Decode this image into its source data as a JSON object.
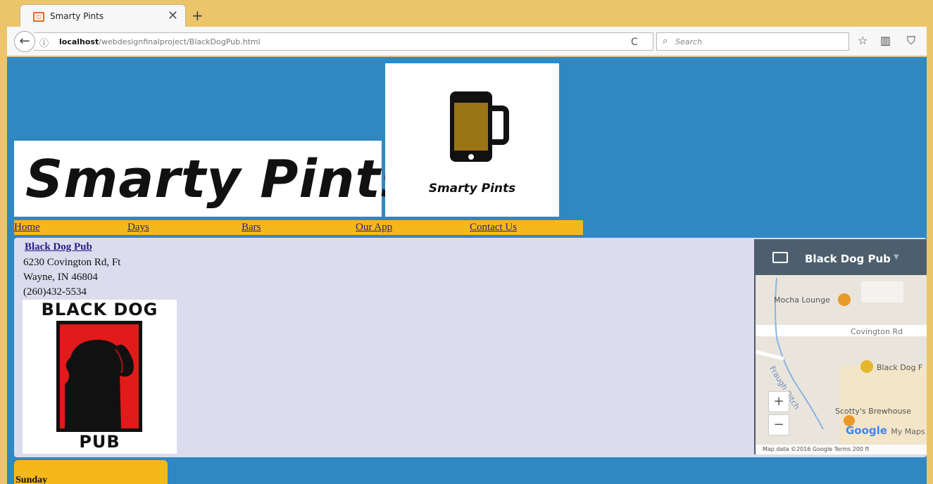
{
  "browser": {
    "tab_title": "Smarty Pints",
    "tab_close": "✕",
    "new_tab": "+",
    "back": "←",
    "url_host": "localhost",
    "url_path": "/webdesignfinalproject/BlackDogPub.html",
    "reload": "C",
    "search_placeholder": "Search",
    "icons": [
      "back-icon",
      "info-icon",
      "reload-icon",
      "search-icon",
      "star-icon",
      "library-icon",
      "pocket-icon"
    ]
  },
  "header": {
    "title": "Smarty Pints",
    "logo_caption": "Smarty Pints"
  },
  "nav": {
    "items": [
      "Home",
      "Days",
      "Bars",
      "Our App",
      "Contact Us"
    ]
  },
  "bar": {
    "name": "Black Dog Pub",
    "address_line1": "6230 Covington Rd, Ft",
    "address_line2": "Wayne, IN 46804",
    "phone": "(260)432-5534",
    "logo_top": "BLACK DOG",
    "logo_bottom": "PUB"
  },
  "map": {
    "title": "Black Dog Pub",
    "labels": {
      "mocha": "Mocha Lounge",
      "road": "Covington Rd",
      "ditch": "Fraugh Ditch",
      "blackdog": "Black Dog F",
      "scotty": "Scotty's Brewhouse"
    },
    "zoom_in": "+",
    "zoom_out": "−",
    "google": "Google",
    "mymaps": "My Maps",
    "footer": "Map data ©2016 Google   Terms   200 ft"
  },
  "day": {
    "label": "Sunday"
  },
  "colors": {
    "page_bg": "#2f88c2",
    "nav_bg": "#f5b81a",
    "content_bg": "#dcdcee",
    "frame": "#ecc56b"
  }
}
